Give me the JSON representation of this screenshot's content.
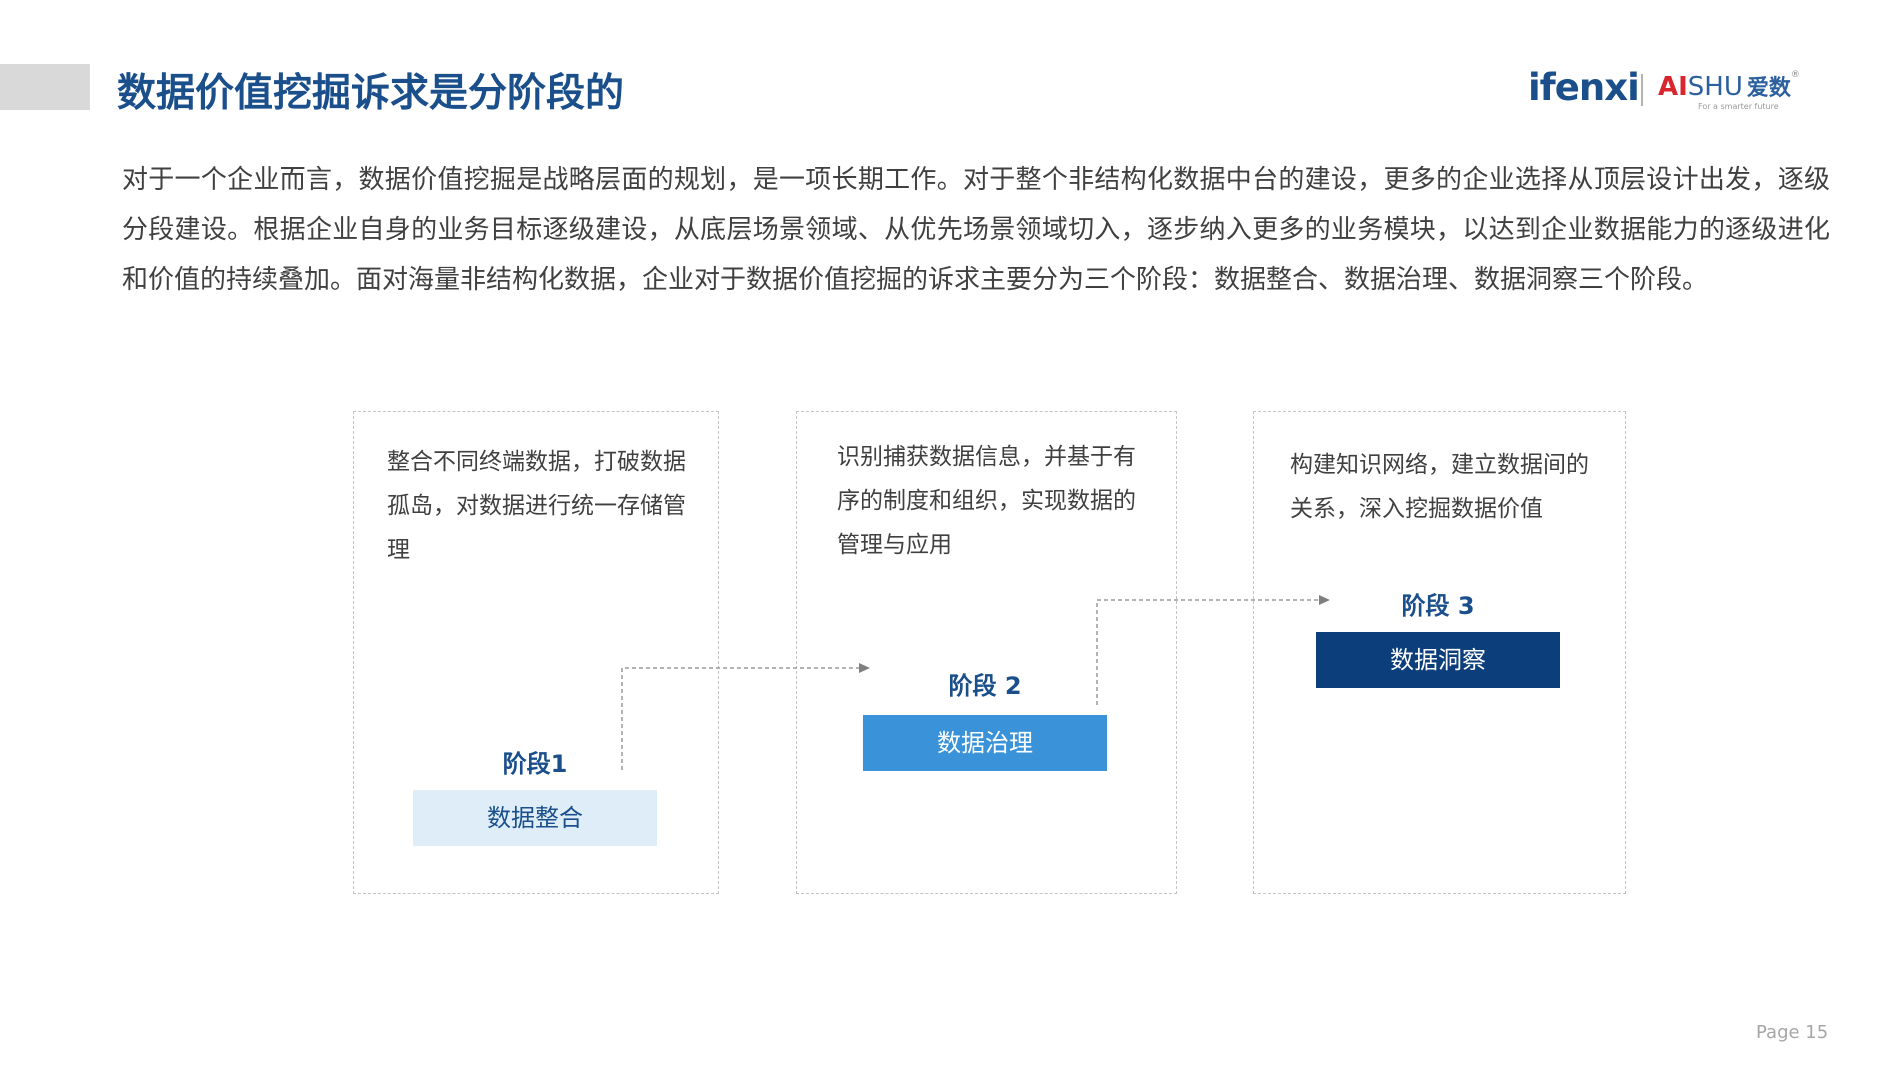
{
  "header": {
    "title": "数据价值挖掘诉求是分阶段的",
    "logo_ifenxi": "ifenxi",
    "logo_aishu_ai": "AI",
    "logo_aishu_shu": "SHU",
    "logo_aishu_cn": "爱数",
    "logo_aishu_reg": "®",
    "logo_tagline": "For a smarter future"
  },
  "intro": "对于一个企业而言，数据价值挖掘是战略层面的规划，是一项长期工作。对于整个非结构化数据中台的建设，更多的企业选择从顶层设计出发，逐级分段建设。根据企业自身的业务目标逐级建设，从底层场景领域、从优先场景领域切入，逐步纳入更多的业务模块，以达到企业数据能力的逐级进化和价值的持续叠加。面对海量非结构化数据，企业对于数据价值挖掘的诉求主要分为三个阶段：数据整合、数据治理、数据洞察三个阶段。",
  "stages": [
    {
      "description": "整合不同终端数据，打破数据孤岛，对数据进行统一存储管理",
      "label": "阶段1",
      "name": "数据整合",
      "color": "#deedf8"
    },
    {
      "description": "识别捕获数据信息，并基于有序的制度和组织，实现数据的管理与应用",
      "label": "阶段 2",
      "name": "数据治理",
      "color": "#3a93d9"
    },
    {
      "description": "构建知识网络，建立数据间的关系，深入挖掘数据价值",
      "label": "阶段 3",
      "name": "数据洞察",
      "color": "#0b3e7a"
    }
  ],
  "footer": {
    "page": "Page  15"
  }
}
